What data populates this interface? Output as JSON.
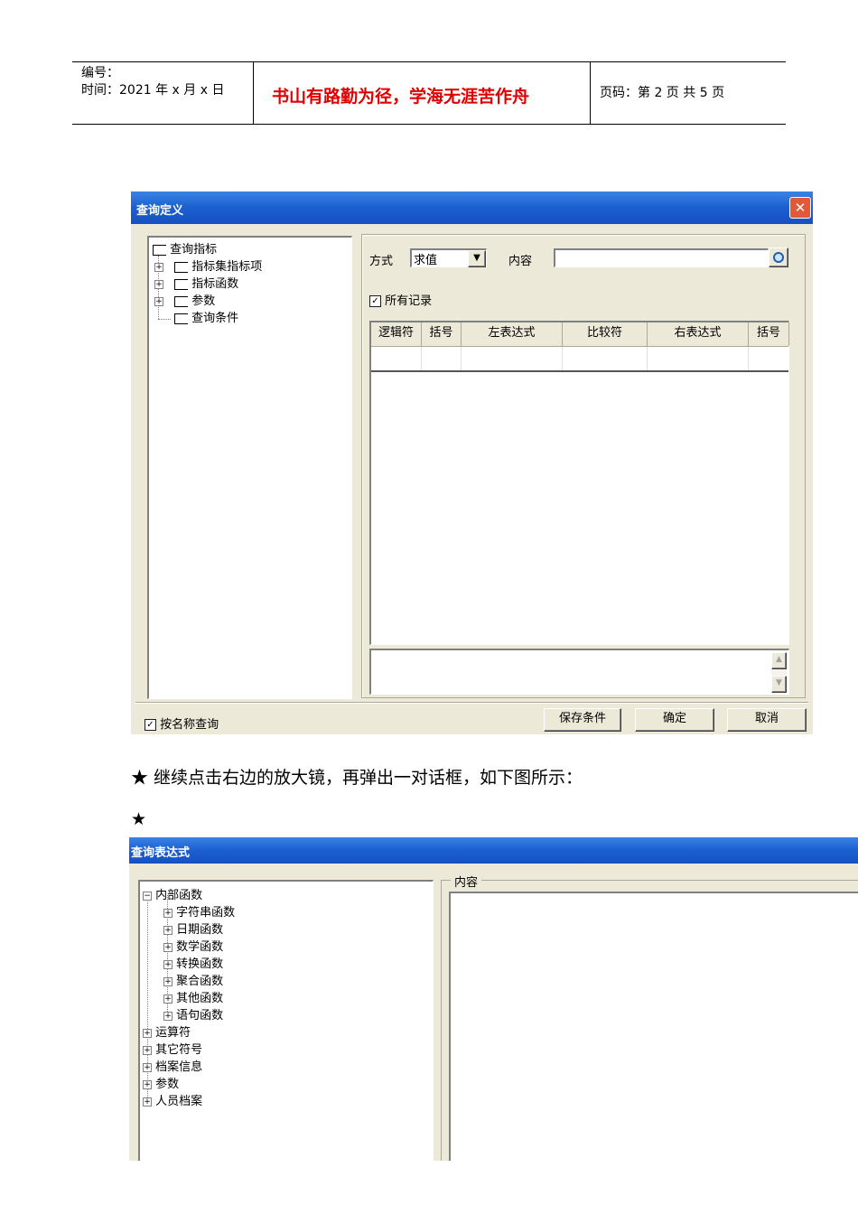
{
  "header": {
    "number_label": "编号：",
    "time_label": "时间：2021 年 x 月 x 日",
    "motto": "书山有路勤为径，学海无涯苦作舟",
    "page_info": "页码：第 2 页  共 5 页"
  },
  "dialog1": {
    "title": "查询定义",
    "close_glyph": "✕",
    "tree": {
      "root": "查询指标",
      "items": [
        "指标集指标项",
        "指标函数",
        "参数",
        "查询条件"
      ]
    },
    "mode_label": "方式",
    "mode_value": "求值",
    "content_label": "内容",
    "all_records_label": "所有记录",
    "columns": [
      "逻辑符",
      "括号",
      "左表达式",
      "比较符",
      "右表达式",
      "括号"
    ],
    "query_by_name_label": "按名称查询",
    "buttons": {
      "save": "保存条件",
      "ok": "确定",
      "cancel": "取消"
    }
  },
  "paragraph": "★ 继续点击右边的放大镜，再弹出一对话框，如下图所示：",
  "star_only": "★",
  "dialog2": {
    "title": "查询表达式",
    "content_label": "内容",
    "tree": {
      "root": "内部函数",
      "children": [
        "字符串函数",
        "日期函数",
        "数学函数",
        "转换函数",
        "聚合函数",
        "其他函数",
        "语句函数"
      ],
      "siblings": [
        "运算符",
        "其它符号",
        "档案信息",
        "参数",
        "人员档案"
      ]
    }
  }
}
